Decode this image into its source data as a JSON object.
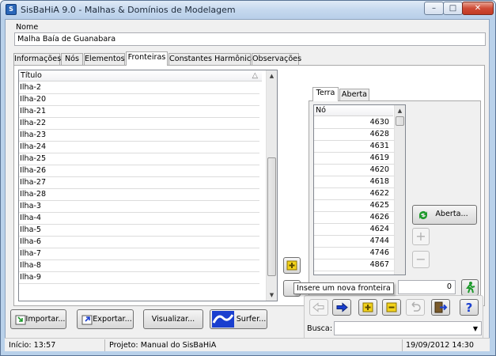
{
  "window": {
    "title": "SisBaHiA 9.0 - Malhas & Domínios de Modelagem",
    "app_icon_text": "S",
    "min_glyph": "–",
    "max_glyph": "□",
    "close_glyph": "✕"
  },
  "name_field": {
    "label": "Nome",
    "value": "Malha Baía de Guanabara"
  },
  "tabs": [
    {
      "label": "Informações"
    },
    {
      "label": "Nós"
    },
    {
      "label": "Elementos"
    },
    {
      "label": "Fronteiras",
      "active": true
    },
    {
      "label": "Constantes Harmônicas"
    },
    {
      "label": "Observações"
    }
  ],
  "fronteiras_list": {
    "header": "Título",
    "sort_glyph": "△",
    "items": [
      "Ilha-2",
      "Ilha-20",
      "Ilha-21",
      "Ilha-22",
      "Ilha-23",
      "Ilha-24",
      "Ilha-25",
      "Ilha-26",
      "Ilha-27",
      "Ilha-28",
      "Ilha-3",
      "Ilha-4",
      "Ilha-5",
      "Ilha-6",
      "Ilha-7",
      "Ilha-8",
      "Ilha-9"
    ],
    "scroll_position": 0.85
  },
  "inner_tabs": [
    {
      "label": "Terra",
      "active": true
    },
    {
      "label": "Aberta"
    }
  ],
  "nodes_list": {
    "header": "Nó",
    "items": [
      "4630",
      "4628",
      "4631",
      "4619",
      "4620",
      "4618",
      "4622",
      "4625",
      "4626",
      "4624",
      "4744",
      "4746",
      "4867"
    ],
    "scroll_position": 0.0
  },
  "buttons": {
    "aberta": "Aberta...",
    "add_plus": "+",
    "remove_minus": "−",
    "insert_frontier_plus": "+",
    "importar": "Importar...",
    "exportar": "Exportar...",
    "visualizar": "Visualizar...",
    "surfer": "Surfer..."
  },
  "tooltip": "Insere um nova fronteira",
  "node_field": {
    "label_fragment": "o:",
    "value": "0"
  },
  "search": {
    "label": "Busca:",
    "value": ""
  },
  "statusbar": {
    "inicio": "Início: 13:57",
    "projeto": "Projeto: Manual do SisBaHiA",
    "datetime": "19/09/2012 14:30"
  },
  "colors": {
    "accent_blue": "#1a3fcf",
    "yellow_icon": "#f2d21b",
    "green_icon": "#1e9a2c",
    "titlebar": "#c5d8ee"
  }
}
